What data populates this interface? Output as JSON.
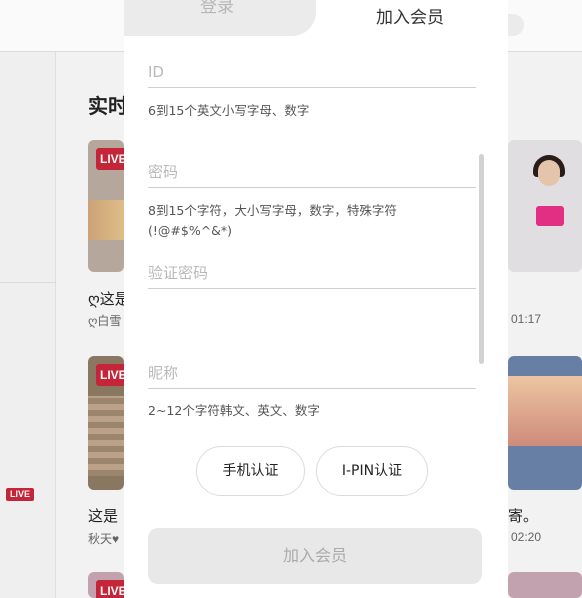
{
  "background": {
    "section_heading": "实时",
    "live_badge": "LIVE",
    "card_texts": [
      {
        "title": "ღ这是",
        "sub": "ღ白雪"
      },
      {
        "title": "这是",
        "sub": "秋天♥"
      }
    ],
    "right_texts": [
      {
        "meta": "01:17"
      },
      {
        "title": "寄。",
        "meta": "02:20"
      }
    ],
    "colors": {
      "live_red": "#c8263a"
    }
  },
  "modal": {
    "tabs": [
      {
        "label": "登录",
        "active": false
      },
      {
        "label": "加入会员",
        "active": true
      }
    ],
    "fields": {
      "id": {
        "placeholder": "ID",
        "value": "",
        "hint": "6到15个英文小写字母、数字"
      },
      "password": {
        "placeholder": "密码",
        "value": "",
        "hint": "8到15个字符，大小写字母，数字，特殊字符 (!@#$%^&*)"
      },
      "password_confirm": {
        "placeholder": "验证密码",
        "value": ""
      },
      "nickname": {
        "placeholder": "昵称",
        "value": "",
        "hint": "2~12个字符韩文、英文、数字"
      }
    },
    "verify_buttons": {
      "phone": "手机认证",
      "ipin": "I-PIN认证"
    },
    "submit_label": "加入会员",
    "colors": {
      "submit_bg": "#e8e8e8",
      "submit_text": "#aaaaaa",
      "inactive_tab_bg": "#ebebeb"
    }
  }
}
